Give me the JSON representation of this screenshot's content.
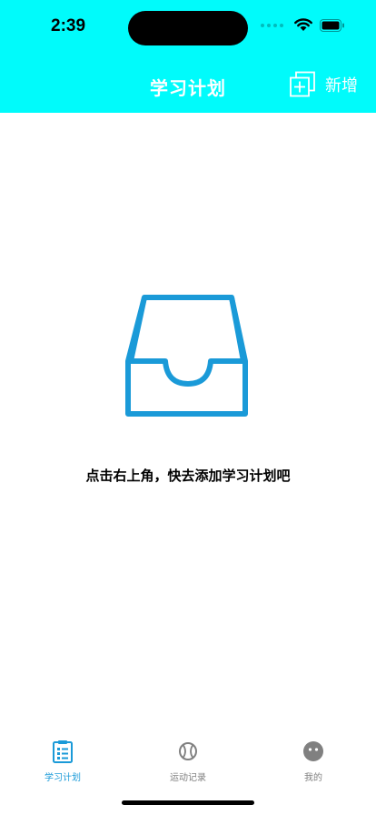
{
  "status": {
    "time": "2:39"
  },
  "nav": {
    "title": "学习计划",
    "add_label": "新增"
  },
  "empty": {
    "message": "点击右上角，快去添加学习计划吧"
  },
  "tabs": [
    {
      "label": "学习计划",
      "icon": "clipboard-icon",
      "active": true
    },
    {
      "label": "运动记录",
      "icon": "baseball-icon",
      "active": false
    },
    {
      "label": "我的",
      "icon": "chat-face-icon",
      "active": false
    }
  ],
  "colors": {
    "header": "#00fbfb",
    "accent": "#1a9ad8",
    "tab_inactive": "#808080"
  }
}
